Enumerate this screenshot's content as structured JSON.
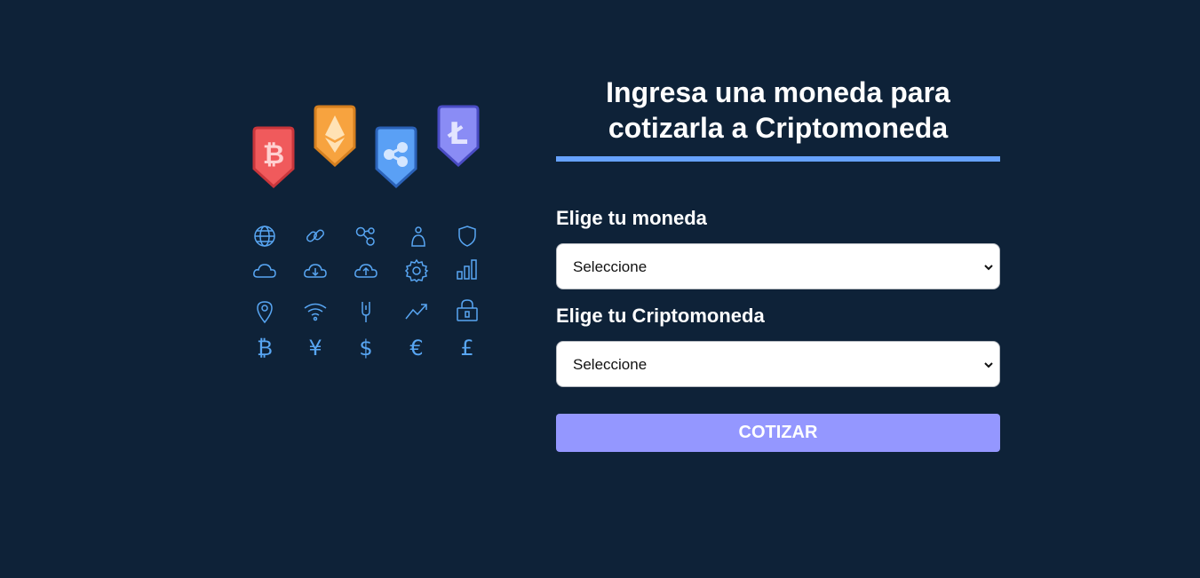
{
  "illustration": {
    "badges": [
      "bitcoin-icon",
      "ethereum-icon",
      "ripple-icon",
      "litecoin-icon"
    ],
    "grid_icons": [
      "globe-icon",
      "link-icon",
      "nodes-icon",
      "person-icon",
      "shield-icon",
      "cloud-icon",
      "cloud-download-icon",
      "cloud-upload-icon",
      "gear-icon",
      "bar-chart-icon",
      "location-pin-icon",
      "wifi-icon",
      "fork-icon",
      "trend-up-icon",
      "lock-icon",
      "bitcoin-glyph-icon",
      "yen-icon",
      "dollar-icon",
      "euro-icon",
      "pound-icon"
    ],
    "currency_glyphs": [
      "₿",
      "¥",
      "$",
      "€",
      "£"
    ],
    "colors": {
      "bitcoin": "#f05a5c",
      "ethereum": "#f7a33f",
      "ripple": "#5aa0f5",
      "litecoin": "#8a8cf5",
      "icons": "#58a6f3"
    }
  },
  "form": {
    "title": "Ingresa una moneda para cotizarla a Criptomoneda",
    "currency_label": "Elige tu moneda",
    "currency_value": "Seleccione",
    "crypto_label": "Elige tu Criptomoneda",
    "crypto_value": "Seleccione",
    "submit_label": "COTIZAR"
  },
  "colors": {
    "background": "#0e2238",
    "accent": "#66a2fe",
    "button": "#9497ff"
  }
}
